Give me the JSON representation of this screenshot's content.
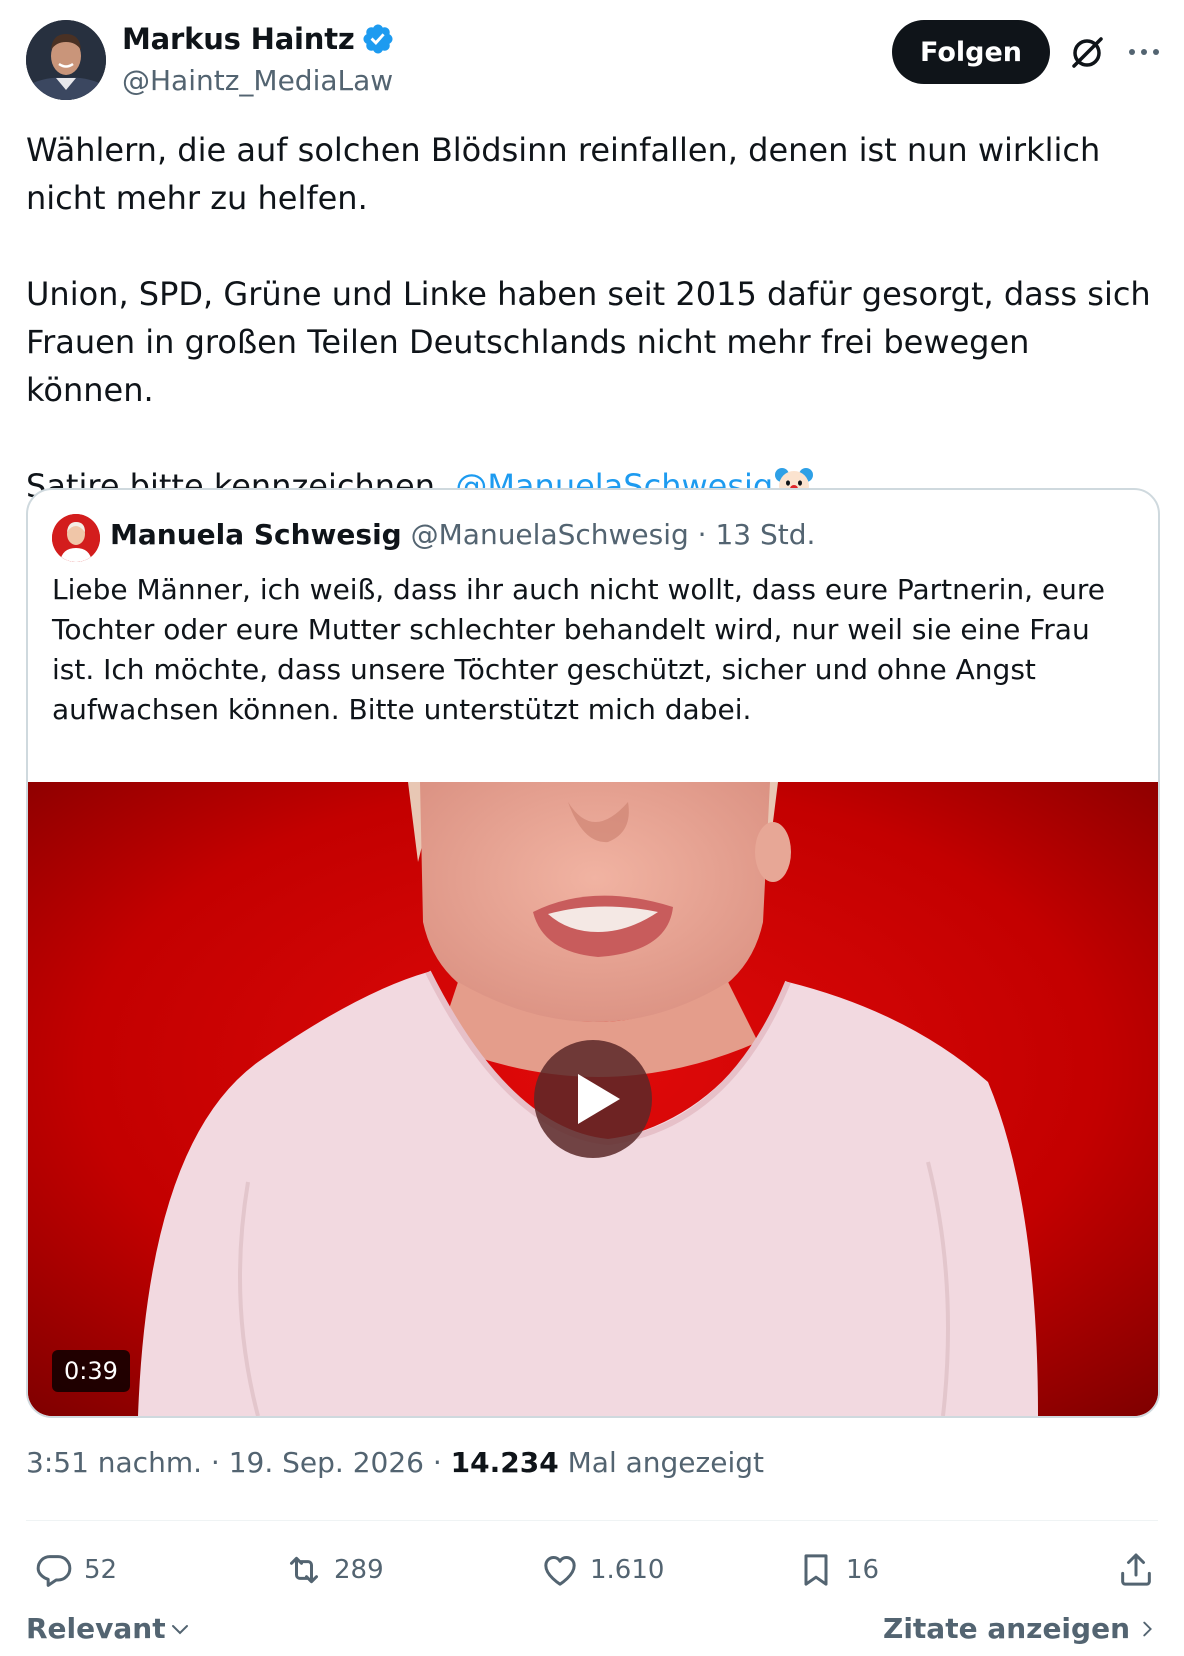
{
  "author": {
    "display_name": "Markus Haintz",
    "handle": "@Haintz_MediaLaw",
    "verified": true
  },
  "header": {
    "follow_label": "Folgen",
    "icons": [
      "grok-icon",
      "more-icon"
    ]
  },
  "post": {
    "paragraphs": [
      "Wählern, die auf solchen Blödsinn reinfallen, denen ist nun wirklich nicht mehr zu helfen.",
      "Union, SPD, Grüne und Linke haben seit 2015 dafür gesorgt, dass sich Frauen in großen Teilen Deutschlands nicht mehr frei bewegen können."
    ],
    "last_line_prefix": "Satire bitte kennzeichnen, ",
    "mention": "@ManuelaSchwesig",
    "emoji": "clown-face"
  },
  "quote": {
    "display_name": "Manuela Schwesig",
    "handle": "@ManuelaSchwesig",
    "time": " · 13 Std.",
    "text": "Liebe Männer, ich weiß, dass ihr auch nicht wollt, dass eure Partnerin, eure Tochter oder eure Mutter schlechter behandelt wird, nur weil sie eine Frau ist. Ich möchte, dass unsere Töchter geschützt, sicher und ohne Angst aufwachsen können. Bitte unterstützt mich dabei.",
    "video": {
      "duration": "0:39"
    }
  },
  "meta": {
    "time": "3:51 nachm.",
    "separator": " · ",
    "date": "19. Sep. 2026",
    "views_count": "14.234",
    "views_label": " Mal angezeigt"
  },
  "actions": {
    "replies": "52",
    "reposts": "289",
    "likes": "1.610",
    "bookmarks": "16"
  },
  "footer": {
    "sort_label": "Relevant",
    "quotes_label": "Zitate anzeigen"
  },
  "colors": {
    "accent": "#1d9bf0",
    "text": "#0f1419",
    "secondary": "#536471",
    "border": "#cfd9de",
    "video_bg": "#c00000"
  }
}
